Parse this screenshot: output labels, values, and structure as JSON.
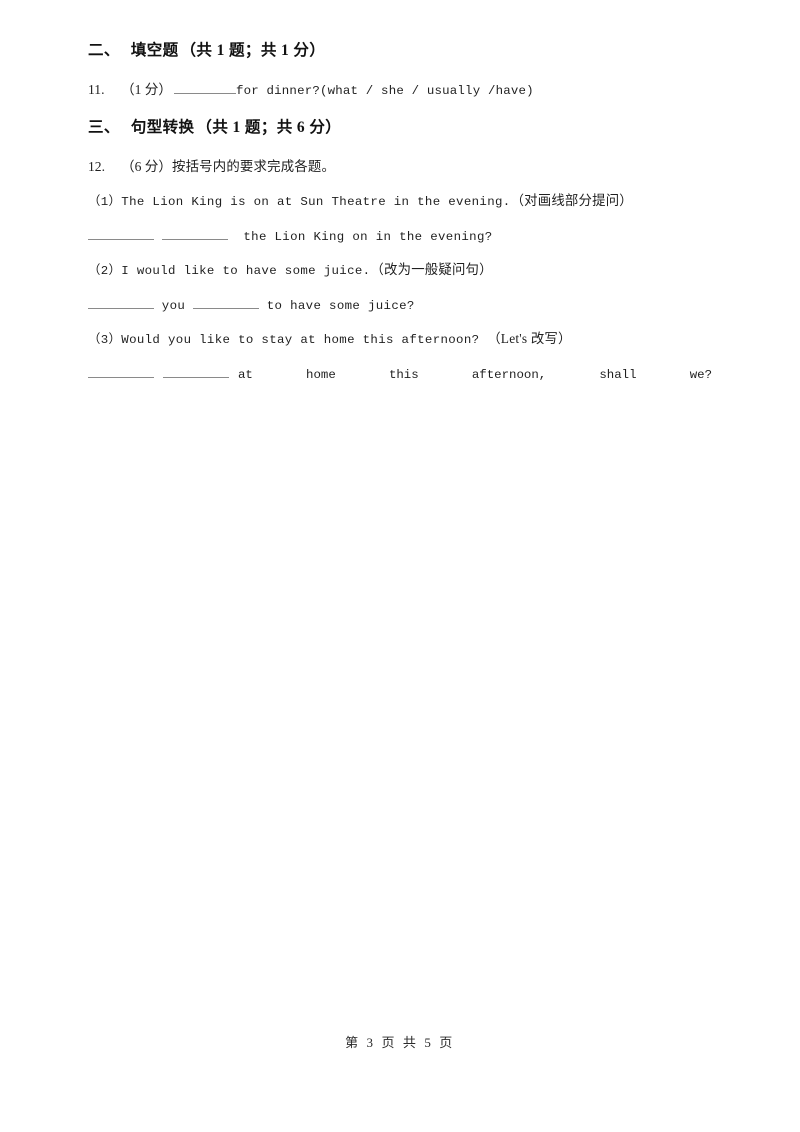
{
  "document": {
    "page_footer": "第 3 页 共 5 页",
    "footer_current_page": "3",
    "footer_total_pages": "5"
  },
  "sections": [
    {
      "number": "二、",
      "title": "填空题",
      "meta": "（共 1 题；共 1 分）",
      "questions": [
        {
          "number": "11.",
          "score": "（1 分）",
          "stem_before_blank": "",
          "stem_after_blank": "for dinner?(what / she / usually /have)"
        }
      ]
    },
    {
      "number": "三、",
      "title": "句型转换",
      "meta": "（共 1 题；共 6 分）",
      "questions": [
        {
          "number": "12.",
          "score": "（6 分）",
          "instruction": "按括号内的要求完成各题。",
          "sub_questions": [
            {
              "label": "（1）",
              "prompt_en": "The Lion King is on at Sun Theatre in the evening.",
              "prompt_cn": "（对画线部分提问）",
              "answer_tail": "the Lion King on in the evening?",
              "blanks": 2
            },
            {
              "label": "（2）",
              "prompt_en": "I would like to have some juice.",
              "prompt_cn": "（改为一般疑问句）",
              "answer_mid": "you",
              "answer_tail": "to have some juice?",
              "blanks": 2
            },
            {
              "label": "（3）",
              "prompt_en": "Would you like to stay at home this afternoon?",
              "prompt_cn": "（Let's 改写）",
              "answer_words": [
                "at",
                "home",
                "this",
                "afternoon,",
                "shall",
                "we?"
              ],
              "blanks": 2
            }
          ]
        }
      ]
    }
  ],
  "colors": {
    "page_background": "#ffffff",
    "text": "#1f1f1f",
    "heading_text": "#111111",
    "blank_rule": "#8a8a8a"
  }
}
